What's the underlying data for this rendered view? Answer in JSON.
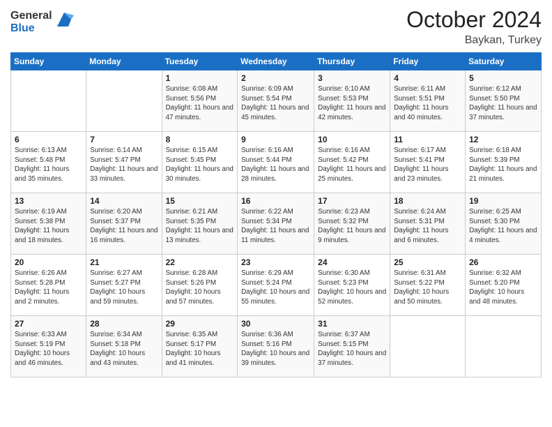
{
  "logo": {
    "general": "General",
    "blue": "Blue"
  },
  "header": {
    "month": "October 2024",
    "location": "Baykan, Turkey"
  },
  "weekdays": [
    "Sunday",
    "Monday",
    "Tuesday",
    "Wednesday",
    "Thursday",
    "Friday",
    "Saturday"
  ],
  "weeks": [
    [
      {
        "day": "",
        "sunrise": "",
        "sunset": "",
        "daylight": ""
      },
      {
        "day": "",
        "sunrise": "",
        "sunset": "",
        "daylight": ""
      },
      {
        "day": "1",
        "sunrise": "Sunrise: 6:08 AM",
        "sunset": "Sunset: 5:56 PM",
        "daylight": "Daylight: 11 hours and 47 minutes."
      },
      {
        "day": "2",
        "sunrise": "Sunrise: 6:09 AM",
        "sunset": "Sunset: 5:54 PM",
        "daylight": "Daylight: 11 hours and 45 minutes."
      },
      {
        "day": "3",
        "sunrise": "Sunrise: 6:10 AM",
        "sunset": "Sunset: 5:53 PM",
        "daylight": "Daylight: 11 hours and 42 minutes."
      },
      {
        "day": "4",
        "sunrise": "Sunrise: 6:11 AM",
        "sunset": "Sunset: 5:51 PM",
        "daylight": "Daylight: 11 hours and 40 minutes."
      },
      {
        "day": "5",
        "sunrise": "Sunrise: 6:12 AM",
        "sunset": "Sunset: 5:50 PM",
        "daylight": "Daylight: 11 hours and 37 minutes."
      }
    ],
    [
      {
        "day": "6",
        "sunrise": "Sunrise: 6:13 AM",
        "sunset": "Sunset: 5:48 PM",
        "daylight": "Daylight: 11 hours and 35 minutes."
      },
      {
        "day": "7",
        "sunrise": "Sunrise: 6:14 AM",
        "sunset": "Sunset: 5:47 PM",
        "daylight": "Daylight: 11 hours and 33 minutes."
      },
      {
        "day": "8",
        "sunrise": "Sunrise: 6:15 AM",
        "sunset": "Sunset: 5:45 PM",
        "daylight": "Daylight: 11 hours and 30 minutes."
      },
      {
        "day": "9",
        "sunrise": "Sunrise: 6:16 AM",
        "sunset": "Sunset: 5:44 PM",
        "daylight": "Daylight: 11 hours and 28 minutes."
      },
      {
        "day": "10",
        "sunrise": "Sunrise: 6:16 AM",
        "sunset": "Sunset: 5:42 PM",
        "daylight": "Daylight: 11 hours and 25 minutes."
      },
      {
        "day": "11",
        "sunrise": "Sunrise: 6:17 AM",
        "sunset": "Sunset: 5:41 PM",
        "daylight": "Daylight: 11 hours and 23 minutes."
      },
      {
        "day": "12",
        "sunrise": "Sunrise: 6:18 AM",
        "sunset": "Sunset: 5:39 PM",
        "daylight": "Daylight: 11 hours and 21 minutes."
      }
    ],
    [
      {
        "day": "13",
        "sunrise": "Sunrise: 6:19 AM",
        "sunset": "Sunset: 5:38 PM",
        "daylight": "Daylight: 11 hours and 18 minutes."
      },
      {
        "day": "14",
        "sunrise": "Sunrise: 6:20 AM",
        "sunset": "Sunset: 5:37 PM",
        "daylight": "Daylight: 11 hours and 16 minutes."
      },
      {
        "day": "15",
        "sunrise": "Sunrise: 6:21 AM",
        "sunset": "Sunset: 5:35 PM",
        "daylight": "Daylight: 11 hours and 13 minutes."
      },
      {
        "day": "16",
        "sunrise": "Sunrise: 6:22 AM",
        "sunset": "Sunset: 5:34 PM",
        "daylight": "Daylight: 11 hours and 11 minutes."
      },
      {
        "day": "17",
        "sunrise": "Sunrise: 6:23 AM",
        "sunset": "Sunset: 5:32 PM",
        "daylight": "Daylight: 11 hours and 9 minutes."
      },
      {
        "day": "18",
        "sunrise": "Sunrise: 6:24 AM",
        "sunset": "Sunset: 5:31 PM",
        "daylight": "Daylight: 11 hours and 6 minutes."
      },
      {
        "day": "19",
        "sunrise": "Sunrise: 6:25 AM",
        "sunset": "Sunset: 5:30 PM",
        "daylight": "Daylight: 11 hours and 4 minutes."
      }
    ],
    [
      {
        "day": "20",
        "sunrise": "Sunrise: 6:26 AM",
        "sunset": "Sunset: 5:28 PM",
        "daylight": "Daylight: 11 hours and 2 minutes."
      },
      {
        "day": "21",
        "sunrise": "Sunrise: 6:27 AM",
        "sunset": "Sunset: 5:27 PM",
        "daylight": "Daylight: 10 hours and 59 minutes."
      },
      {
        "day": "22",
        "sunrise": "Sunrise: 6:28 AM",
        "sunset": "Sunset: 5:26 PM",
        "daylight": "Daylight: 10 hours and 57 minutes."
      },
      {
        "day": "23",
        "sunrise": "Sunrise: 6:29 AM",
        "sunset": "Sunset: 5:24 PM",
        "daylight": "Daylight: 10 hours and 55 minutes."
      },
      {
        "day": "24",
        "sunrise": "Sunrise: 6:30 AM",
        "sunset": "Sunset: 5:23 PM",
        "daylight": "Daylight: 10 hours and 52 minutes."
      },
      {
        "day": "25",
        "sunrise": "Sunrise: 6:31 AM",
        "sunset": "Sunset: 5:22 PM",
        "daylight": "Daylight: 10 hours and 50 minutes."
      },
      {
        "day": "26",
        "sunrise": "Sunrise: 6:32 AM",
        "sunset": "Sunset: 5:20 PM",
        "daylight": "Daylight: 10 hours and 48 minutes."
      }
    ],
    [
      {
        "day": "27",
        "sunrise": "Sunrise: 6:33 AM",
        "sunset": "Sunset: 5:19 PM",
        "daylight": "Daylight: 10 hours and 46 minutes."
      },
      {
        "day": "28",
        "sunrise": "Sunrise: 6:34 AM",
        "sunset": "Sunset: 5:18 PM",
        "daylight": "Daylight: 10 hours and 43 minutes."
      },
      {
        "day": "29",
        "sunrise": "Sunrise: 6:35 AM",
        "sunset": "Sunset: 5:17 PM",
        "daylight": "Daylight: 10 hours and 41 minutes."
      },
      {
        "day": "30",
        "sunrise": "Sunrise: 6:36 AM",
        "sunset": "Sunset: 5:16 PM",
        "daylight": "Daylight: 10 hours and 39 minutes."
      },
      {
        "day": "31",
        "sunrise": "Sunrise: 6:37 AM",
        "sunset": "Sunset: 5:15 PM",
        "daylight": "Daylight: 10 hours and 37 minutes."
      },
      {
        "day": "",
        "sunrise": "",
        "sunset": "",
        "daylight": ""
      },
      {
        "day": "",
        "sunrise": "",
        "sunset": "",
        "daylight": ""
      }
    ]
  ]
}
